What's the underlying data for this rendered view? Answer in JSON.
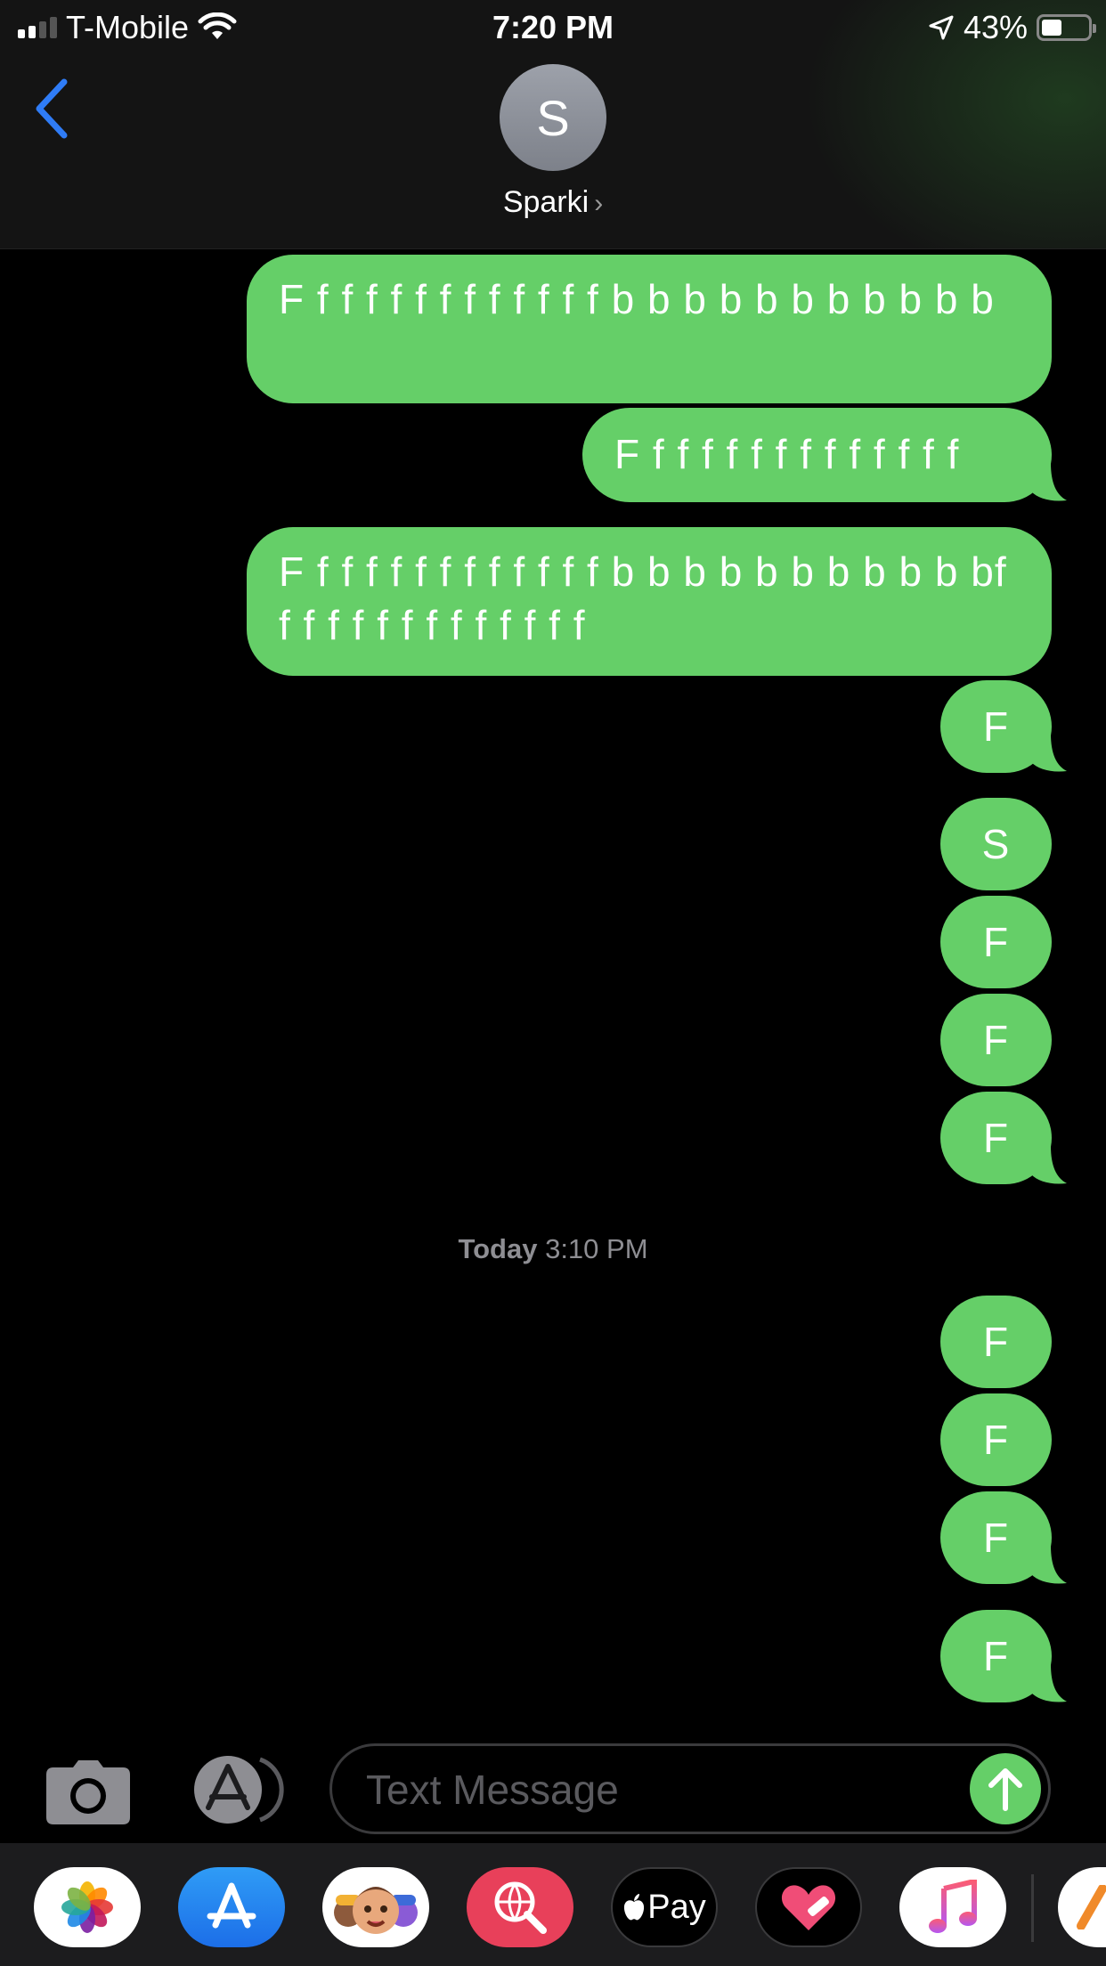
{
  "status_bar": {
    "carrier": "T-Mobile",
    "time": "7:20 PM",
    "battery": "43%"
  },
  "header": {
    "avatar_initial": "S",
    "contact_name": "Sparki"
  },
  "messages": [
    {
      "text": "F f f f f f f f f f f f f b b b b b b b b b b b"
    },
    {
      "text": "F f f f f f f f f f f f f f"
    },
    {
      "text": "F f f f f f f f f f f f f b b b b b b b b b b bf f f f f f f f f f f f f f"
    },
    {
      "text": "F"
    },
    {
      "text": "S"
    },
    {
      "text": "F"
    },
    {
      "text": "F"
    },
    {
      "text": "F"
    },
    {
      "text": "F"
    },
    {
      "text": "F"
    },
    {
      "text": "F"
    },
    {
      "text": "F"
    }
  ],
  "timestamp": {
    "day": "Today",
    "time": "3:10 PM"
  },
  "composer": {
    "placeholder": "Text Message"
  },
  "dock": {
    "apps": [
      "photos-icon",
      "app-store-icon",
      "memoji-icon",
      "image-search-icon",
      "apple-pay-icon",
      "heart-app-icon",
      "music-icon",
      "partial-app-icon"
    ],
    "apple_pay_label": "Pay"
  },
  "colors": {
    "bubble": "#65cf68",
    "accent_blue": "#2f7cf6"
  }
}
